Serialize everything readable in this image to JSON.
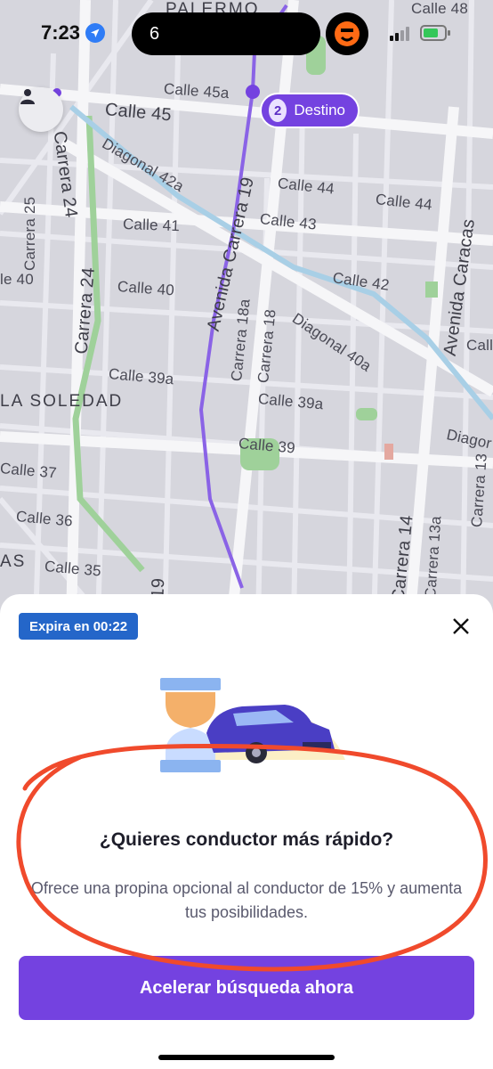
{
  "status_bar": {
    "time": "7:23",
    "island_text": "6"
  },
  "map": {
    "labels": {
      "palermo": "PALERMO",
      "calle_48": "Calle 48",
      "calle_45a": "Calle 45a",
      "calle_45": "Calle 45",
      "diagonal_42a": "Diagonal 42a",
      "carrera_24_top": "Carrera 24",
      "carrera_25": "Carrera 25",
      "calle_41": "Calle 41",
      "le_40": "le 40",
      "carrera_24_mid": "Carrera 24",
      "calle_40": "Calle 40",
      "avenida_carrera_19": "Avenida Carrera 19",
      "calle_44_a": "Calle 44",
      "calle_44_b": "Calle 44",
      "calle_43": "Calle 43",
      "avenida_caracas": "Avenida Caracas",
      "calle_42": "Calle 42",
      "carrera_18a": "Carrera 18a",
      "carrera_18": "Carrera 18",
      "diagonal_40a": "Diagonal 40a",
      "calle_cut": "Call",
      "calle_39a_left": "Calle 39a",
      "la_soledad": "LA SOLEDAD",
      "calle_39a_right": "Calle 39a",
      "diagonal_cut": "Diagor",
      "calle_39": "Calle 39",
      "calle_37": "Calle 37",
      "carrera_13": "Carrera 13",
      "calle_36": "Calle 36",
      "carrera_14": "Carrera 14",
      "carrera_13a": "Carrera 13a",
      "as": "AS",
      "calle_35": "Calle 35",
      "num_19": "19"
    },
    "destination": {
      "number": "2",
      "label": "Destino"
    }
  },
  "sheet": {
    "expire_badge": "Expira en 00:22",
    "title": "¿Quieres conductor más rápido?",
    "description": "Ofrece una propina opcional al conductor de 15% y aumenta tus posibilidades.",
    "cta_label": "Acelerar búsqueda ahora"
  },
  "colors": {
    "brand_purple": "#7442e0",
    "badge_blue": "#2466c9",
    "map_background": "#d6d6dd",
    "route": "#8a63e6",
    "annotation_red": "#f04a2c"
  }
}
